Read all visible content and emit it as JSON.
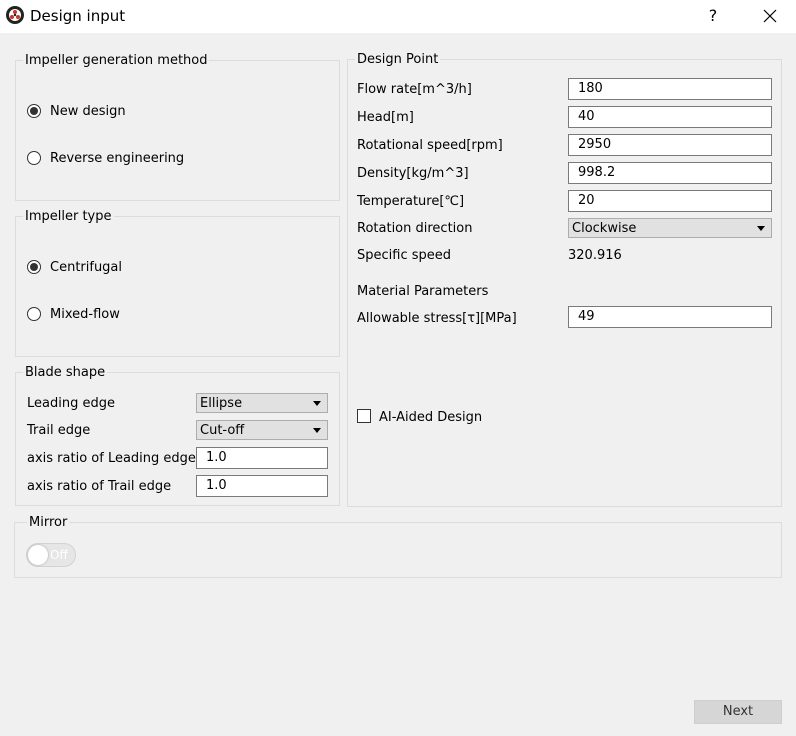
{
  "window": {
    "title": "Design input",
    "help_label": "?"
  },
  "impeller_method": {
    "legend": "Impeller generation method",
    "options": [
      {
        "label": "New design",
        "selected": true
      },
      {
        "label": "Reverse engineering",
        "selected": false
      }
    ]
  },
  "impeller_type": {
    "legend": "Impeller type",
    "options": [
      {
        "label": "Centrifugal",
        "selected": true
      },
      {
        "label": "Mixed-flow",
        "selected": false
      }
    ]
  },
  "blade_shape": {
    "legend": "Blade shape",
    "leading_edge_label": "Leading edge",
    "leading_edge_value": "Ellipse",
    "trail_edge_label": "Trail edge",
    "trail_edge_value": "Cut-off",
    "axis_leading_label": "axis ratio of Leading edge",
    "axis_leading_value": "1.0",
    "axis_trail_label": "axis ratio of Trail edge",
    "axis_trail_value": "1.0"
  },
  "design_point": {
    "legend": "Design Point",
    "flow_rate_label": "Flow rate[m^3/h]",
    "flow_rate_value": "180",
    "head_label": "Head[m]",
    "head_value": "40",
    "rot_speed_label": "Rotational speed[rpm]",
    "rot_speed_value": "2950",
    "density_label": "Density[kg/m^3]",
    "density_value": "998.2",
    "temperature_label": "Temperature[℃]",
    "temperature_value": "20",
    "rotation_dir_label": "Rotation direction",
    "rotation_dir_value": "Clockwise",
    "specific_speed_label": "Specific speed",
    "specific_speed_value": "320.916",
    "material_heading": "Material Parameters",
    "allowable_stress_label": "Allowable stress[τ][MPa]",
    "allowable_stress_value": "49",
    "ai_aided_label": "AI-Aided Design",
    "ai_aided_checked": false
  },
  "mirror": {
    "legend": "Mirror",
    "toggle_label": "Off",
    "toggle_on": false
  },
  "footer": {
    "next_label": "Next"
  },
  "colors": {
    "background": "#f0f0f0",
    "titlebar": "#ffffff",
    "border": "#dcdcdc"
  }
}
